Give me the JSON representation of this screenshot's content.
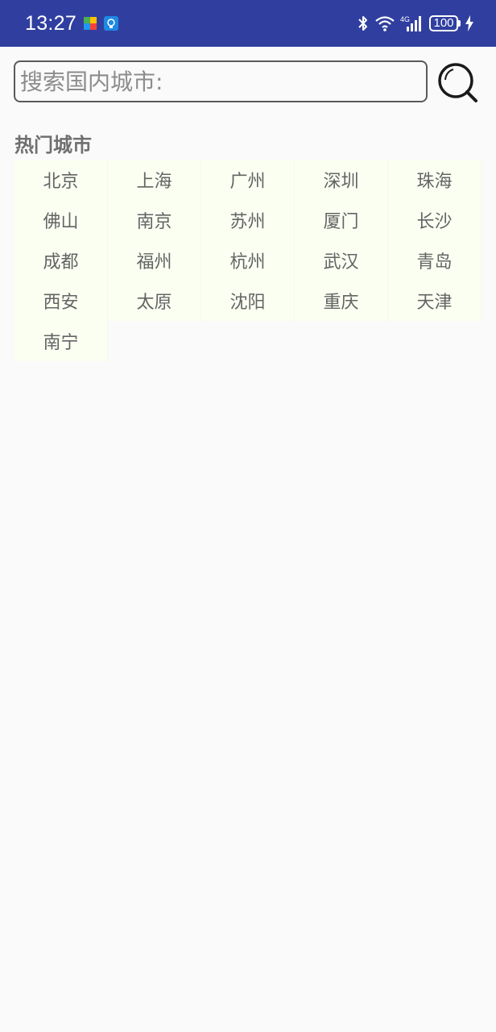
{
  "status_bar": {
    "time": "13:27",
    "battery": "100",
    "network": "4G",
    "background": "#303f9f"
  },
  "search": {
    "placeholder": "搜索国内城市:",
    "icon": "magnifier-icon"
  },
  "hot_cities": {
    "title": "热门城市",
    "cities": [
      "北京",
      "上海",
      "广州",
      "深圳",
      "珠海",
      "佛山",
      "南京",
      "苏州",
      "厦门",
      "长沙",
      "成都",
      "福州",
      "杭州",
      "武汉",
      "青岛",
      "西安",
      "太原",
      "沈阳",
      "重庆",
      "天津",
      "南宁"
    ]
  },
  "colors": {
    "cell_background": "#fbfff2",
    "text": "#646464"
  }
}
